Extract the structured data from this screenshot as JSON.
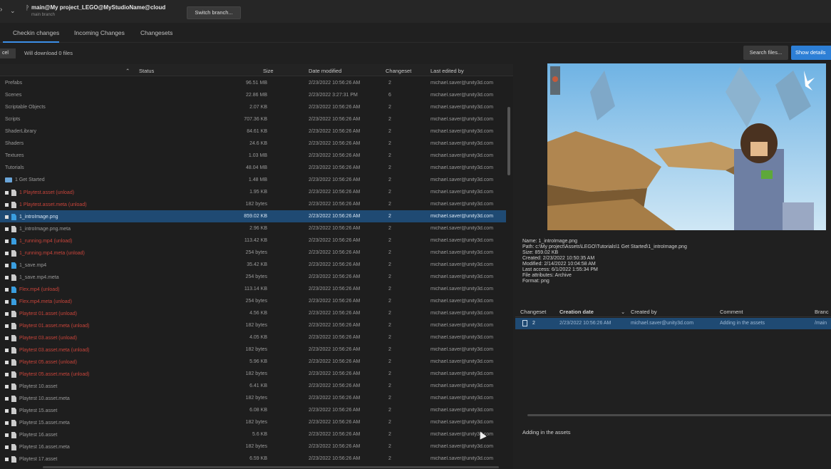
{
  "topbar": {
    "branch_name": "main@My project_LEGO@MyStudioName@cloud",
    "branch_sub": "main branch",
    "switch_button": "Switch branch..."
  },
  "tabs": [
    {
      "label": "Checkin changes"
    },
    {
      "label": "Incoming Changes"
    },
    {
      "label": "Changesets"
    }
  ],
  "toolbar": {
    "undo_label": "cel",
    "download_status": "Will download 0 files",
    "search_button": "Search files...",
    "show_details_button": "Show details"
  },
  "table": {
    "headers": {
      "status": "Status",
      "size": "Size",
      "date": "Date modified",
      "changeset": "Changeset",
      "user": "Last edited by"
    },
    "rows": [
      {
        "name": "Prefabs",
        "size": "96.51 MB",
        "date": "2/23/2022 10:56:26 AM",
        "cs": "2",
        "user": "michael.saver@unity3d.com"
      },
      {
        "name": "Scenes",
        "size": "22.86 MB",
        "date": "2/23/2022 3:27:31 PM",
        "cs": "6",
        "user": "michael.saver@unity3d.com"
      },
      {
        "name": "Scriptable Objects",
        "size": "2.07 KB",
        "date": "2/23/2022 10:56:26 AM",
        "cs": "2",
        "user": "michael.saver@unity3d.com"
      },
      {
        "name": "Scripts",
        "size": "707.36 KB",
        "date": "2/23/2022 10:56:26 AM",
        "cs": "2",
        "user": "michael.saver@unity3d.com"
      },
      {
        "name": "ShaderLibrary",
        "size": "84.61 KB",
        "date": "2/23/2022 10:56:26 AM",
        "cs": "2",
        "user": "michael.saver@unity3d.com"
      },
      {
        "name": "Shaders",
        "size": "24.6 KB",
        "date": "2/23/2022 10:56:26 AM",
        "cs": "2",
        "user": "michael.saver@unity3d.com"
      },
      {
        "name": "Textures",
        "size": "1.03 MB",
        "date": "2/23/2022 10:56:26 AM",
        "cs": "2",
        "user": "michael.saver@unity3d.com"
      },
      {
        "name": "Tutorials",
        "size": "48.04 MB",
        "date": "2/23/2022 10:56:26 AM",
        "cs": "2",
        "user": "michael.saver@unity3d.com"
      },
      {
        "name": "1 Get Started",
        "size": "1.48 MB",
        "date": "2/23/2022 10:56:26 AM",
        "cs": "2",
        "user": "michael.saver@unity3d.com"
      },
      {
        "name": "1 Playtest.asset (unload)",
        "size": "1.95 KB",
        "date": "2/23/2022 10:56:26 AM",
        "cs": "2",
        "user": "michael.saver@unity3d.com"
      },
      {
        "name": "1 Playtest.asset.meta (unload)",
        "size": "182 bytes",
        "date": "2/23/2022 10:56:26 AM",
        "cs": "2",
        "user": "michael.saver@unity3d.com"
      },
      {
        "name": "1_introImage.png",
        "size": "859.02 KB",
        "date": "2/23/2022 10:56:26 AM",
        "cs": "2",
        "user": "michael.saver@unity3d.com"
      },
      {
        "name": "1_introImage.png.meta",
        "size": "2.96 KB",
        "date": "2/23/2022 10:56:26 AM",
        "cs": "2",
        "user": "michael.saver@unity3d.com"
      },
      {
        "name": "1_running.mp4 (unload)",
        "size": "113.42 KB",
        "date": "2/23/2022 10:56:26 AM",
        "cs": "2",
        "user": "michael.saver@unity3d.com"
      },
      {
        "name": "1_running.mp4.meta (unload)",
        "size": "254 bytes",
        "date": "2/23/2022 10:56:26 AM",
        "cs": "2",
        "user": "michael.saver@unity3d.com"
      },
      {
        "name": "1_save.mp4",
        "size": "35.42 KB",
        "date": "2/23/2022 10:56:26 AM",
        "cs": "2",
        "user": "michael.saver@unity3d.com"
      },
      {
        "name": "1_save.mp4.meta",
        "size": "254 bytes",
        "date": "2/23/2022 10:56:26 AM",
        "cs": "2",
        "user": "michael.saver@unity3d.com"
      },
      {
        "name": "Flex.mp4 (unload)",
        "size": "113.14 KB",
        "date": "2/23/2022 10:56:26 AM",
        "cs": "2",
        "user": "michael.saver@unity3d.com"
      },
      {
        "name": "Flex.mp4.meta (unload)",
        "size": "254 bytes",
        "date": "2/23/2022 10:56:26 AM",
        "cs": "2",
        "user": "michael.saver@unity3d.com"
      },
      {
        "name": "Playtest 01.asset (unload)",
        "size": "4.56 KB",
        "date": "2/23/2022 10:56:26 AM",
        "cs": "2",
        "user": "michael.saver@unity3d.com"
      },
      {
        "name": "Playtest 01.asset.meta (unload)",
        "size": "182 bytes",
        "date": "2/23/2022 10:56:26 AM",
        "cs": "2",
        "user": "michael.saver@unity3d.com"
      },
      {
        "name": "Playtest 03.asset (unload)",
        "size": "4.05 KB",
        "date": "2/23/2022 10:56:26 AM",
        "cs": "2",
        "user": "michael.saver@unity3d.com"
      },
      {
        "name": "Playtest 03.asset.meta (unload)",
        "size": "182 bytes",
        "date": "2/23/2022 10:56:26 AM",
        "cs": "2",
        "user": "michael.saver@unity3d.com"
      },
      {
        "name": "Playtest 05.asset (unload)",
        "size": "5.96 KB",
        "date": "2/23/2022 10:56:26 AM",
        "cs": "2",
        "user": "michael.saver@unity3d.com"
      },
      {
        "name": "Playtest 05.asset.meta (unload)",
        "size": "182 bytes",
        "date": "2/23/2022 10:56:26 AM",
        "cs": "2",
        "user": "michael.saver@unity3d.com"
      },
      {
        "name": "Playtest 10.asset",
        "size": "6.41 KB",
        "date": "2/23/2022 10:56:26 AM",
        "cs": "2",
        "user": "michael.saver@unity3d.com"
      },
      {
        "name": "Playtest 10.asset.meta",
        "size": "182 bytes",
        "date": "2/23/2022 10:56:26 AM",
        "cs": "2",
        "user": "michael.saver@unity3d.com"
      },
      {
        "name": "Playtest 15.asset",
        "size": "6.08 KB",
        "date": "2/23/2022 10:56:26 AM",
        "cs": "2",
        "user": "michael.saver@unity3d.com"
      },
      {
        "name": "Playtest 15.asset.meta",
        "size": "182 bytes",
        "date": "2/23/2022 10:56:26 AM",
        "cs": "2",
        "user": "michael.saver@unity3d.com"
      },
      {
        "name": "Playtest 16.asset",
        "size": "5.6 KB",
        "date": "2/23/2022 10:56:26 AM",
        "cs": "2",
        "user": "michael.saver@unity3d.com"
      },
      {
        "name": "Playtest 16.asset.meta",
        "size": "182 bytes",
        "date": "2/23/2022 10:56:26 AM",
        "cs": "2",
        "user": "michael.saver@unity3d.com"
      },
      {
        "name": "Playtest 17.asset",
        "size": "6.59 KB",
        "date": "2/23/2022 10:56:26 AM",
        "cs": "2",
        "user": "michael.saver@unity3d.com"
      }
    ]
  },
  "details": {
    "name": "Name: 1_introImage.png",
    "path": "Path: c:\\My project\\Assets\\LEGO\\Tutorials\\1 Get Started\\1_introImage.png",
    "size": "Size: 859.02 KB",
    "created": "Created: 2/23/2022 10:50:35 AM",
    "modified": "Modified: 2/14/2022 10:04:58 AM",
    "accessed": "Last access: 6/1/2022 1:55:34 PM",
    "attributes": "File attributes: Archive",
    "format": "Format: png"
  },
  "changesets": {
    "headers": {
      "changeset": "Changeset",
      "creation": "Creation date",
      "created_by": "Created by",
      "comment": "Comment",
      "branch": "Branc"
    },
    "row": {
      "id": "2",
      "date": "2/23/2022 10:56:26 AM",
      "user": "michael.saver@unity3d.com",
      "comment": "Adding in the assets",
      "branch": "/main"
    }
  },
  "comment_text": "Adding in the assets"
}
